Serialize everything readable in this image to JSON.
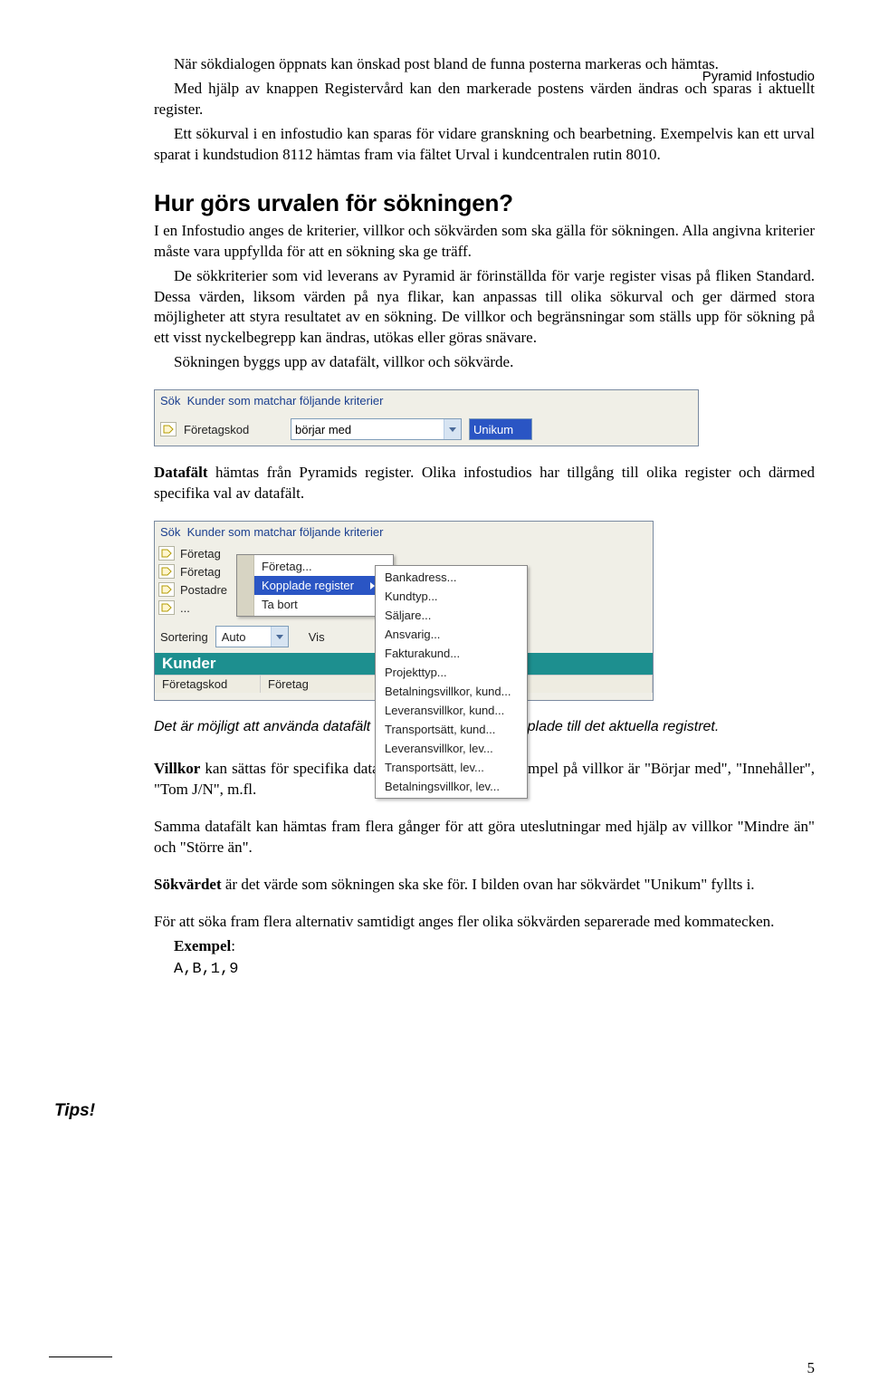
{
  "running_head": "Pyramid Infostudio",
  "page_number": "5",
  "intro": {
    "p1": "När sökdialogen öppnats kan önskad post bland de funna posterna markeras och hämtas.",
    "p2": "Med hjälp av knappen Registervård kan den markerade postens värden ändras och sparas i aktuellt register.",
    "p3": "Ett sökurval i en infostudio kan sparas för vidare granskning och bearbetning. Exempelvis kan ett urval sparat i kundstudion 8112 hämtas fram via fältet Urval i kundcentralen rutin 8010."
  },
  "section_heading": "Hur görs urvalen för sökningen?",
  "section": {
    "p1": "I en Infostudio anges de kriterier, villkor och sökvärden som ska gälla för sökningen. Alla angivna kriterier måste vara uppfyllda för att en sökning ska ge träff.",
    "p2": "De sökkriterier som vid leverans av Pyramid är förinställda för varje register visas på fliken Standard. Dessa värden, liksom värden på nya flikar, kan anpassas till olika sökurval och ger därmed stora möjligheter att styra resultatet av en sökning. De villkor och begränsningar som ställs upp för sökning på ett visst nyckelbegrepp kan ändras, utökas eller göras snävare.",
    "p3": "Sökningen byggs upp av datafält, villkor och sökvärde."
  },
  "fig1": {
    "sok_prefix": "Sök",
    "sok_text": "Kunder som matchar följande kriterier",
    "field_label": "Företagskod",
    "condition": "börjar med",
    "value": "Unikum"
  },
  "para_datafalt_lead": "Datafält",
  "para_datafalt_rest": " hämtas från Pyramids register. Olika infostudios har tillgång till olika register och därmed specifika val av datafält.",
  "fig2": {
    "sok_prefix": "Sök",
    "sok_text": "Kunder som matchar följande kriterier",
    "rows": [
      "Företag",
      "Företag",
      "Postadre",
      "..."
    ],
    "sortering_label": "Sortering",
    "sortering_value": "Auto",
    "visa_label": "Vis",
    "kunder_bar": "Kunder",
    "th1": "Företagskod",
    "th2": "Företag",
    "menu": {
      "item1": "Företag...",
      "item2": "Kopplade register",
      "item3": "Ta bort"
    },
    "submenu": [
      "Bankadress...",
      "Kundtyp...",
      "Säljare...",
      "Ansvarig...",
      "Fakturakund...",
      "Projekttyp...",
      "Betalningsvillkor, kund...",
      "Leveransvillkor, kund...",
      "Transportsätt, kund...",
      "Leveransvillkor, lev...",
      "Transportsätt, lev...",
      "Betalningsvillkor, lev..."
    ]
  },
  "note_text": "Det är möjligt att använda datafält från register som är kopplade till det aktuella registret.",
  "villkor_lead": "Villkor",
  "villkor_rest": " kan sättas för specifika datafält i en Infostudio. Exempel på villkor är \"Börjar med\", \"Innehåller\", \"Tom J/N\", m.fl.",
  "tips_label": "Tips!",
  "tips_para": "Samma datafält kan hämtas fram flera gånger för att göra uteslutningar med hjälp av villkor \"Mindre än\" och \"Större än\".",
  "sokvarde_lead": "Sökvärdet",
  "sokvarde_rest": " är det värde som sökningen ska ske för. I bilden ovan har sökvärdet \"Unikum\" fyllts i.",
  "multi_para": "För att söka fram flera alternativ samtidigt anges fler olika sökvärden separerade med kommatecken.",
  "exempel_label": "Exempel",
  "exempel_code": "A,B,1,9"
}
